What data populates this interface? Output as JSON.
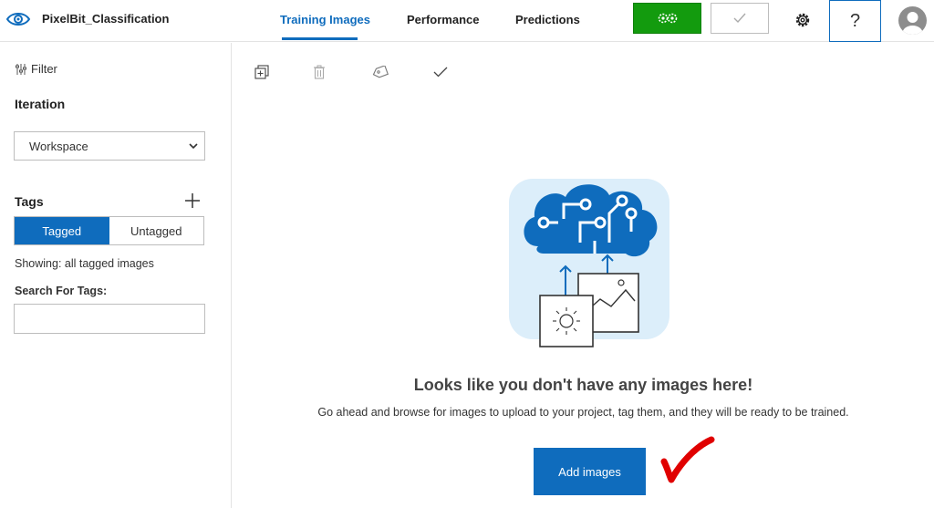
{
  "header": {
    "project_name": "PixelBit_Classification",
    "tabs": [
      {
        "label": "Training Images",
        "active": true
      },
      {
        "label": "Performance",
        "active": false
      },
      {
        "label": "Predictions",
        "active": false
      }
    ],
    "help_label": "?",
    "train_icon": "gears-icon",
    "publish_icon": "check-icon",
    "settings_icon": "gear-icon",
    "accent_color": "#0f6cbd",
    "train_color": "#139b0e"
  },
  "sidebar": {
    "filter_label": "Filter",
    "iteration_heading": "Iteration",
    "iteration_value": "Workspace",
    "tags_heading": "Tags",
    "tag_options": [
      "Tagged",
      "Untagged"
    ],
    "selected_tag_option": "Tagged",
    "showing_text": "Showing: all tagged images",
    "search_label": "Search For Tags:",
    "search_value": ""
  },
  "toolbar": {
    "icons": [
      "add-image-icon",
      "delete-icon",
      "tag-icon",
      "select-check-icon"
    ]
  },
  "empty_state": {
    "title": "Looks like you don't have any images here!",
    "description": "Go ahead and browse for images to upload to your project, tag them, and they will be ready to be trained.",
    "button_label": "Add images",
    "annotation_color": "#e00000"
  }
}
